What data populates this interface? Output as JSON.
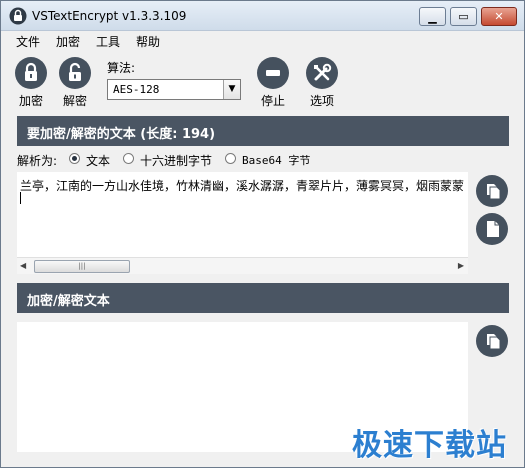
{
  "window": {
    "title": "VSTextEncrypt v1.3.3.109"
  },
  "menu": {
    "items": [
      "文件",
      "加密",
      "工具",
      "帮助"
    ]
  },
  "toolbar": {
    "encrypt_label": "加密",
    "decrypt_label": "解密",
    "algorithm_label": "算法:",
    "algorithm_value": "AES-128",
    "stop_label": "停止",
    "options_label": "选项"
  },
  "input_section": {
    "header": "要加密/解密的文本 (长度: 194)",
    "parse_label": "解析为:",
    "radio_options": [
      "文本",
      "十六进制字节",
      "Base64 字节"
    ],
    "selected_option": "文本",
    "text": "兰亭，江南的一方山水佳境，竹林清幽，溪水潺潺，青翠片片，薄雾冥冥，烟雨蒙蒙"
  },
  "output_section": {
    "header": "加密/解密文本"
  },
  "watermark": "极速下载站",
  "colors": {
    "header_bg": "#4a5563",
    "icon_bg": "#45515e",
    "watermark": "#2c7fd0"
  }
}
